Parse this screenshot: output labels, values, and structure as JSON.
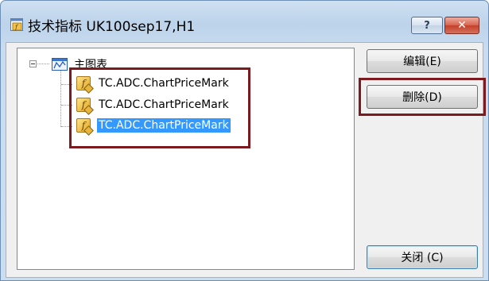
{
  "window": {
    "title": "技术指标 UK100sep17,H1",
    "help_label": "?",
    "close_label": "✕"
  },
  "tree": {
    "root_label": "主图表",
    "items": [
      {
        "label": "TC.ADC.ChartPriceMark",
        "selected": false
      },
      {
        "label": "TC.ADC.ChartPriceMark",
        "selected": false
      },
      {
        "label": "TC.ADC.ChartPriceMark",
        "selected": true
      }
    ],
    "fx_glyph": "f"
  },
  "buttons": {
    "edit": "编辑(E)",
    "delete": "删除(D)",
    "close": "关闭 (C)"
  },
  "icons": {
    "app": "indicator-app-icon",
    "root": "chart-icon",
    "item": "function-icon"
  },
  "colors": {
    "highlight_box": "#7b1a1f",
    "selection": "#3399ff"
  }
}
